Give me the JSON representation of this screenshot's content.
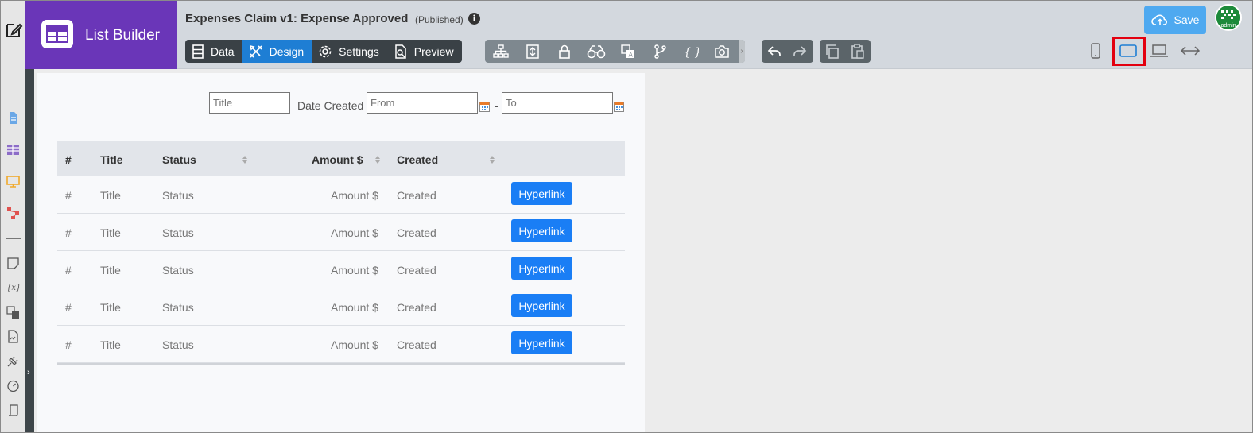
{
  "brand": {
    "title": "List Builder"
  },
  "header": {
    "title": "Expenses Claim v1: Expense Approved",
    "status": "(Published)",
    "info_glyph": "i"
  },
  "mode_tabs": [
    {
      "label": "Data",
      "icon": "data-icon",
      "active": false
    },
    {
      "label": "Design",
      "icon": "design-icon",
      "active": true
    },
    {
      "label": "Settings",
      "icon": "gear-icon",
      "active": false
    },
    {
      "label": "Preview",
      "icon": "preview-icon",
      "active": false
    }
  ],
  "toolbar_icons": [
    "sitemap-icon",
    "form-icon",
    "lock-icon",
    "binoculars-icon",
    "translate-icon",
    "branch-icon",
    "braces-icon",
    "camera-icon"
  ],
  "edit_icons": [
    "undo-icon",
    "redo-icon",
    "copy-icon",
    "paste-icon"
  ],
  "device_icons": [
    "phone-icon",
    "tablet-icon",
    "laptop-icon",
    "full-width-icon"
  ],
  "selected_device": "tablet",
  "save": {
    "label": "Save"
  },
  "avatar": {
    "text": "admin"
  },
  "filters": {
    "title_placeholder": "Title",
    "date_label": "Date Created",
    "from_placeholder": "From",
    "range_separator": "-",
    "to_placeholder": "To"
  },
  "grid": {
    "columns": [
      "#",
      "Title",
      "Status",
      "Amount $",
      "Created"
    ],
    "rows": [
      {
        "num": "#",
        "title": "Title",
        "status": "Status",
        "amount": "Amount $",
        "created": "Created",
        "link": "Hyperlink"
      },
      {
        "num": "#",
        "title": "Title",
        "status": "Status",
        "amount": "Amount $",
        "created": "Created",
        "link": "Hyperlink"
      },
      {
        "num": "#",
        "title": "Title",
        "status": "Status",
        "amount": "Amount $",
        "created": "Created",
        "link": "Hyperlink"
      },
      {
        "num": "#",
        "title": "Title",
        "status": "Status",
        "amount": "Amount $",
        "created": "Created",
        "link": "Hyperlink"
      },
      {
        "num": "#",
        "title": "Title",
        "status": "Status",
        "amount": "Amount $",
        "created": "Created",
        "link": "Hyperlink"
      }
    ]
  },
  "colors": {
    "brand": "#6a36b8",
    "accent": "#1e7ed4",
    "link_button": "#1a7ef5",
    "save_button": "#4ea9f0",
    "selection": "#e3000f"
  },
  "left_rail_icons": [
    "page-icon",
    "table-icon",
    "monitor-icon",
    "workflow-icon",
    "note-icon",
    "variable-icon",
    "translate-icon",
    "document-icon",
    "plug-icon",
    "dashboard-icon",
    "script-icon"
  ]
}
